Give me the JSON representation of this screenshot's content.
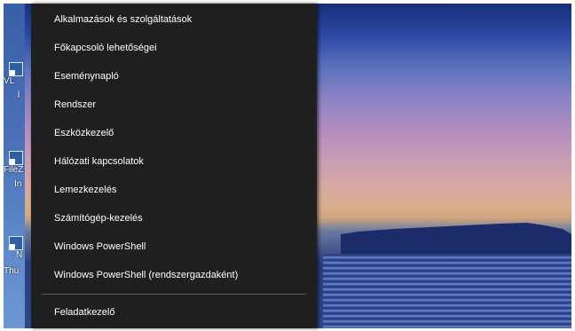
{
  "menu": {
    "items": [
      "Alkalmazások és szolgáltatások",
      "Főkapcsoló lehetőségei",
      "Eseménynapló",
      "Rendszer",
      "Eszközkezelő",
      "Hálózati kapcsolatok",
      "Lemezkezelés",
      "Számítógép-kezelés",
      "Windows PowerShell",
      "Windows PowerShell (rendszergazdaként)"
    ],
    "after_separator": [
      "Feladatkezelő"
    ]
  },
  "desktop": {
    "icons": [
      {
        "label": "VL",
        "icon": "shortcut-icon"
      },
      {
        "label": "FileZ",
        "icon": "shortcut-icon"
      },
      {
        "label": "N",
        "icon": "shortcut-icon"
      }
    ],
    "icon_text_fragments": [
      "l",
      "In",
      "Thu"
    ]
  }
}
